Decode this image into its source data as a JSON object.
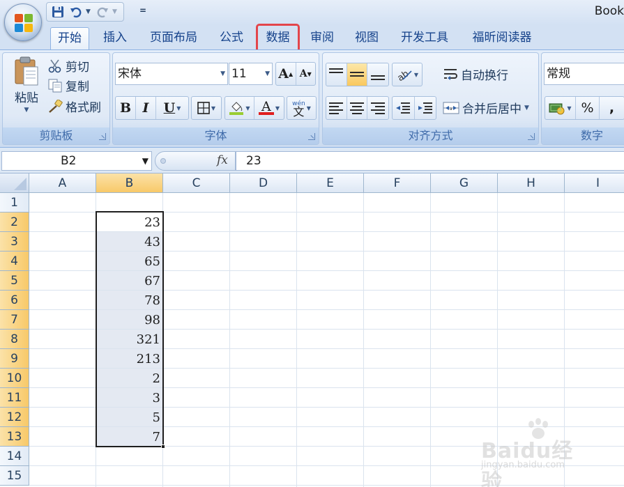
{
  "window": {
    "title": "Book"
  },
  "tabs": [
    {
      "label": "开始",
      "active": true,
      "highlighted": false
    },
    {
      "label": "插入",
      "active": false,
      "highlighted": false
    },
    {
      "label": "页面布局",
      "active": false,
      "highlighted": false
    },
    {
      "label": "公式",
      "active": false,
      "highlighted": false
    },
    {
      "label": "数据",
      "active": false,
      "highlighted": true
    },
    {
      "label": "审阅",
      "active": false,
      "highlighted": false
    },
    {
      "label": "视图",
      "active": false,
      "highlighted": false
    },
    {
      "label": "开发工具",
      "active": false,
      "highlighted": false
    },
    {
      "label": "福昕阅读器",
      "active": false,
      "highlighted": false
    }
  ],
  "ribbon": {
    "clipboard": {
      "label": "剪贴板",
      "paste": "粘贴",
      "cut": "剪切",
      "copy": "复制",
      "format_painter": "格式刷"
    },
    "font": {
      "label": "字体",
      "font_name": "宋体",
      "font_size": "11",
      "bold": "B",
      "italic": "I",
      "underline": "U",
      "font_color_glyph": "A",
      "grow": "A",
      "shrink": "A"
    },
    "alignment": {
      "label": "对齐方式",
      "wrap_text": "自动换行",
      "merge_center": "合并后居中"
    },
    "number": {
      "label": "数字",
      "format": "常规",
      "percent": "%",
      "comma": ","
    }
  },
  "formula_bar": {
    "name_box": "B2",
    "fx": "fx",
    "content": "23"
  },
  "sheet": {
    "columns": [
      "A",
      "B",
      "C",
      "D",
      "E",
      "F",
      "G",
      "H",
      "I"
    ],
    "rows": [
      "1",
      "2",
      "3",
      "4",
      "5",
      "6",
      "7",
      "8",
      "9",
      "10",
      "11",
      "12",
      "13",
      "14",
      "15"
    ],
    "selected_column": "B",
    "selected_range": "B2:B13",
    "column_b_values": [
      "23",
      "43",
      "65",
      "67",
      "78",
      "98",
      "321",
      "213",
      "2",
      "3",
      "5",
      "7"
    ]
  },
  "watermark": {
    "text": "Baidu经验",
    "sub": "jingyan.baidu.com"
  },
  "colors": {
    "accent_highlight": "#e3454b",
    "selection_header": "#f8c969",
    "tab_text": "#15428b"
  }
}
